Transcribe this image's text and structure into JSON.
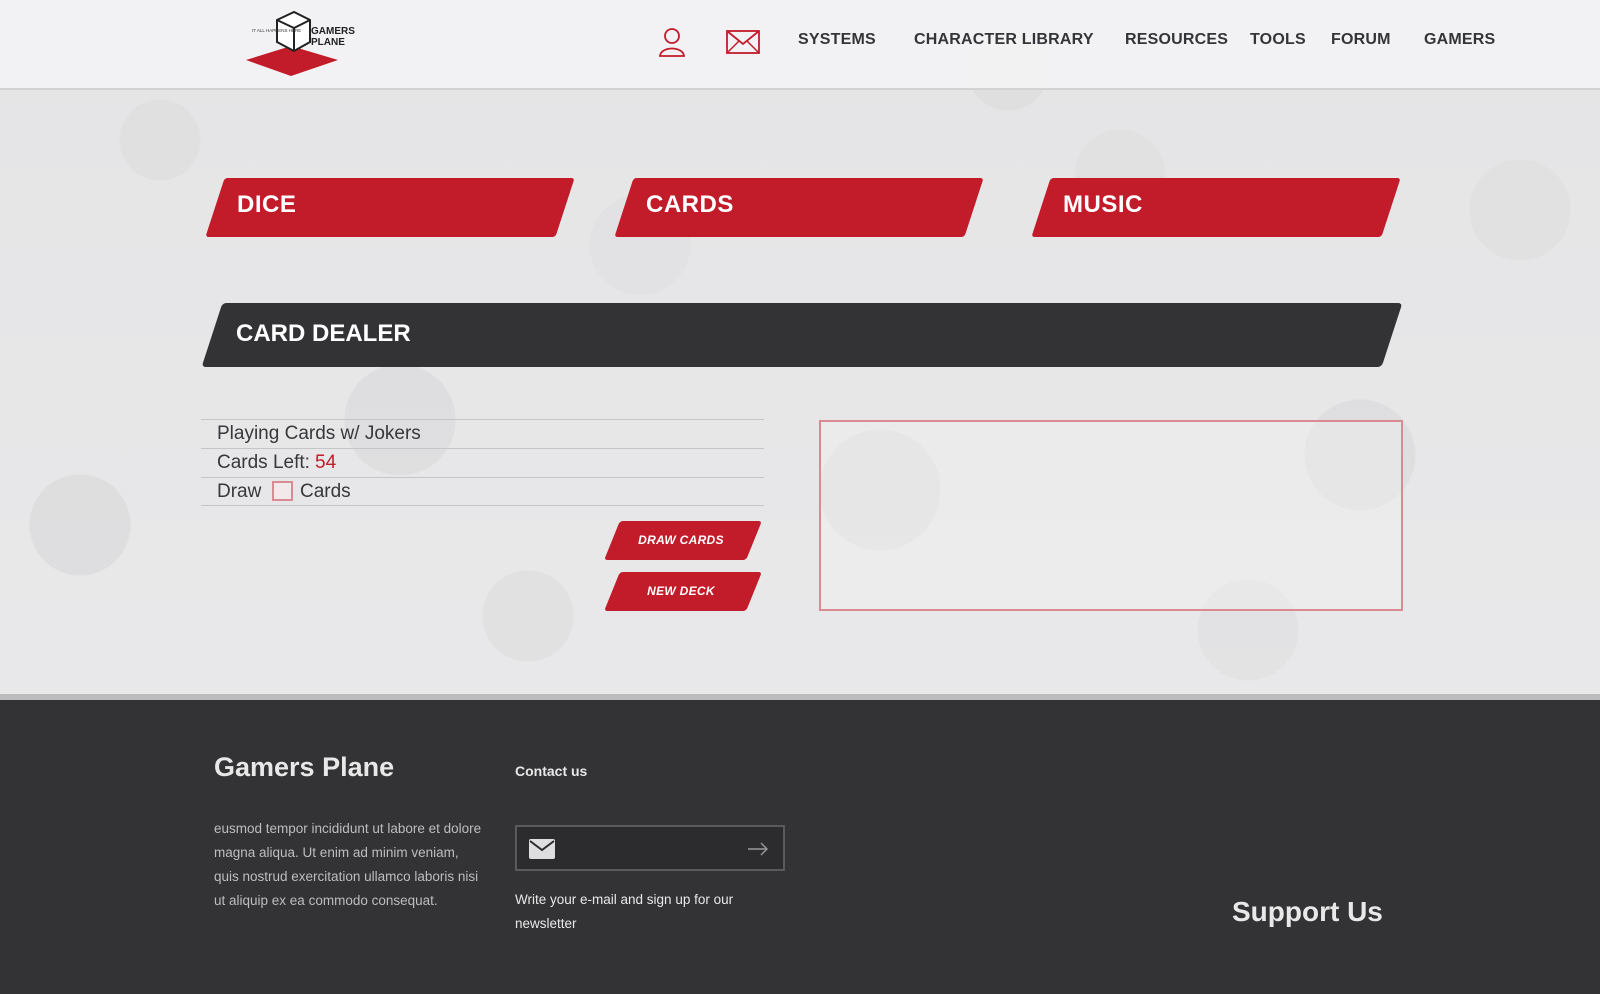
{
  "header": {
    "logo": {
      "tagline": "IT ALL HAPPENS HERE",
      "name_line1": "GAMERS",
      "name_line2": "PLANE"
    },
    "icons": [
      "user-icon",
      "mail-icon"
    ],
    "nav": [
      "SYSTEMS",
      "CHARACTER LIBRARY",
      "RESOURCES",
      "TOOLS",
      "FORUM",
      "GAMERS"
    ]
  },
  "tools": {
    "tabs": [
      "DICE",
      "CARDS",
      "MUSIC"
    ]
  },
  "dealer": {
    "title": "CARD DEALER",
    "deck_name": "Playing Cards w/ Jokers",
    "cards_left_label": "Cards Left:",
    "cards_left_value": "54",
    "draw_label": "Draw",
    "draw_value": "",
    "cards_label": "Cards",
    "draw_button": "DRAW CARDS",
    "new_deck_button": "NEW DECK"
  },
  "footer": {
    "title": "Gamers Plane",
    "text": "eusmod tempor incididunt ut labore et dolore magna aliqua. Ut enim ad minim veniam, quis nostrud exercitation ullamco laboris nisi ut aliquip ex ea commodo consequat.",
    "contact_title": "Contact us",
    "email_value": "",
    "newsletter": "Write your e-mail and sign up for our newsletter",
    "support": "Support Us"
  },
  "colors": {
    "accent": "#c21b2a",
    "dark": "#333335",
    "text": "#37383b"
  }
}
